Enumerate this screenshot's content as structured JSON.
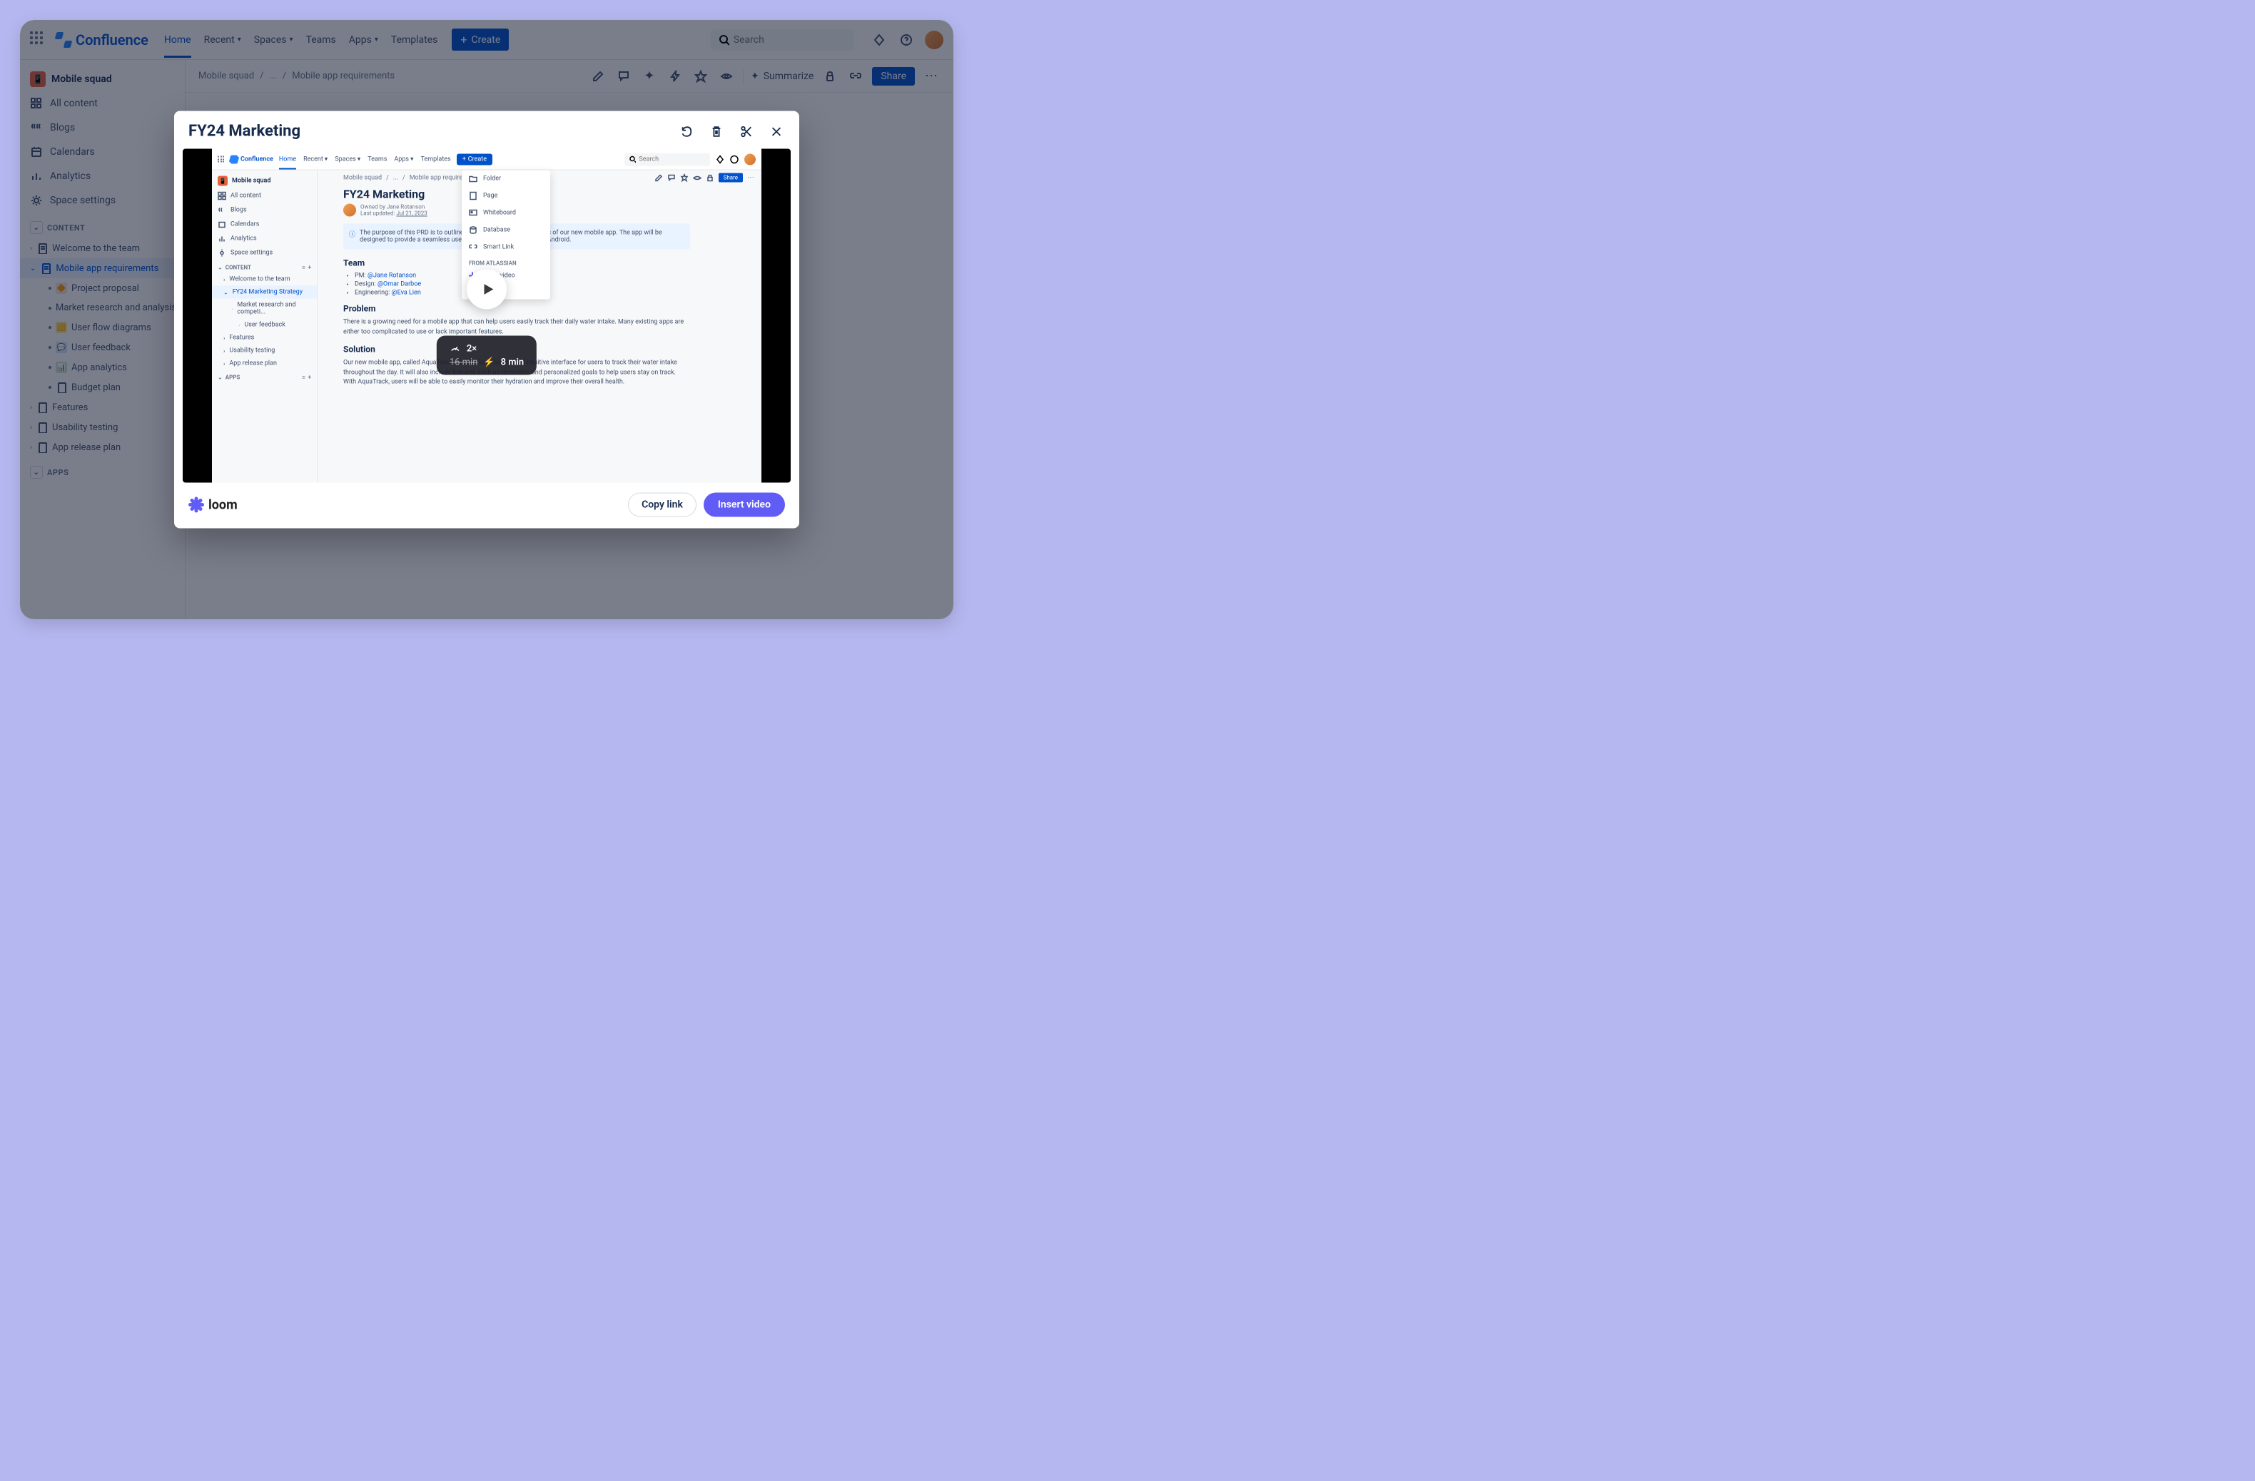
{
  "app": {
    "name": "Confluence",
    "nav": [
      "Home",
      "Recent",
      "Spaces",
      "Teams",
      "Apps",
      "Templates"
    ],
    "nav_has_dropdown": [
      false,
      true,
      true,
      false,
      true,
      false
    ],
    "active_nav": "Home",
    "create_label": "Create",
    "search_placeholder": "Search"
  },
  "sidebar": {
    "space_name": "Mobile squad",
    "items": [
      {
        "icon": "all",
        "label": "All content"
      },
      {
        "icon": "blogs",
        "label": "Blogs"
      },
      {
        "icon": "calendar",
        "label": "Calendars"
      },
      {
        "icon": "analytics",
        "label": "Analytics"
      },
      {
        "icon": "settings",
        "label": "Space settings"
      }
    ],
    "content_label": "CONTENT",
    "apps_label": "APPS",
    "tree": [
      {
        "level": 0,
        "icon": "page",
        "label": "Welcome to the team",
        "expandable": true
      },
      {
        "level": 0,
        "icon": "page",
        "label": "Mobile app requirements",
        "expandable": true,
        "selected": true
      },
      {
        "level": 1,
        "icon": "proposal",
        "label": "Project proposal",
        "bg": "#f7e6d5"
      },
      {
        "level": 1,
        "icon": "doc",
        "label": "Market research and analysis",
        "dot": true
      },
      {
        "level": 1,
        "icon": "flow",
        "label": "User flow diagrams",
        "bg": "#f5e7a0"
      },
      {
        "level": 1,
        "icon": "feedback",
        "label": "User feedback",
        "bg": "#cce7ff"
      },
      {
        "level": 1,
        "icon": "analytics2",
        "label": "App analytics",
        "bg": "#c8e6c9"
      },
      {
        "level": 1,
        "icon": "page",
        "label": "Budget plan"
      },
      {
        "level": 0,
        "icon": "page",
        "label": "Features",
        "expandable": true
      },
      {
        "level": 0,
        "icon": "page",
        "label": "Usability testing",
        "expandable": true
      },
      {
        "level": 0,
        "icon": "page",
        "label": "App release plan",
        "expandable": true
      }
    ]
  },
  "page_header": {
    "breadcrumbs": [
      "Mobile squad",
      "...",
      "Mobile app requirements"
    ],
    "summarize_label": "Summarize",
    "share_label": "Share"
  },
  "modal": {
    "title": "FY24 Marketing",
    "loom_brand": "loom",
    "copy_link_label": "Copy link",
    "insert_label": "Insert video",
    "speed_value": "2×",
    "old_duration": "16 min",
    "new_duration": "8 min"
  },
  "video_content": {
    "breadcrumbs": [
      "Mobile squad",
      "...",
      "Mobile app requirements"
    ],
    "share_label": "Share",
    "page_title": "FY24 Marketing",
    "owner_line": "Owned by Jane Rotanson",
    "updated_line": "Last updated: ",
    "updated_date": "Jul 21, 2023",
    "info_text": "The purpose of this PRD is to outline the requirements and features of our new mobile app. The app will be designed to provide a seamless user experience, for both iOS and Android.",
    "team_heading": "Team",
    "team_list": [
      {
        "role": "PM:",
        "mention": "@Jane Rotanson"
      },
      {
        "role": "Design:",
        "mention": "@Omar Darboe"
      },
      {
        "role": "Engineering:",
        "mention": "@Eva Lien"
      }
    ],
    "problem_heading": "Problem",
    "problem_text": "There is a growing need for a mobile app that can help users easily track their daily water intake. Many existing apps are either too complicated to use or lack important features.",
    "solution_heading": "Solution",
    "solution_text": "Our new mobile app, called AquaTrack, will provide a simple and intuitive interface for users to track their water intake throughout the day. It will also include features such as reminders and personalized goals to help users stay on track. With AquaTrack, users will be able to easily monitor their hydration and improve their overall health.",
    "dropdown": {
      "items": [
        "Folder",
        "Page",
        "Whiteboard",
        "Database",
        "Smart Link"
      ],
      "section_label": "FROM ATLASSIAN",
      "section_items": [
        "Loom video"
      ]
    },
    "mini_sidebar": {
      "space_name": "Mobile squad",
      "items": [
        "All content",
        "Blogs",
        "Calendars",
        "Analytics",
        "Space settings"
      ],
      "content_label": "CONTENT",
      "apps_label": "APPS",
      "tree": [
        {
          "level": 0,
          "label": "Welcome to the team"
        },
        {
          "level": 0,
          "label": "FY24 Marketing Strategy",
          "selected": true
        },
        {
          "level": 1,
          "label": "Market research and competi..."
        },
        {
          "level": 2,
          "label": "User feedback"
        },
        {
          "level": 0,
          "label": "Features"
        },
        {
          "level": 0,
          "label": "Usability testing"
        },
        {
          "level": 0,
          "label": "App release plan"
        }
      ]
    }
  }
}
